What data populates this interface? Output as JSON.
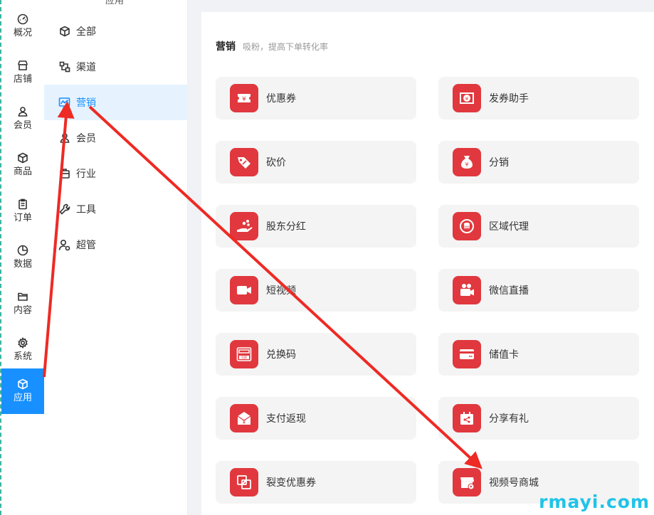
{
  "rail": {
    "items": [
      {
        "label": "概况",
        "icon": "dashboard-icon"
      },
      {
        "label": "店铺",
        "icon": "store-icon"
      },
      {
        "label": "会员",
        "icon": "user-icon"
      },
      {
        "label": "商品",
        "icon": "box-icon"
      },
      {
        "label": "订单",
        "icon": "clipboard-icon"
      },
      {
        "label": "数据",
        "icon": "pie-icon"
      },
      {
        "label": "内容",
        "icon": "folder-icon"
      },
      {
        "label": "系统",
        "icon": "gear-icon"
      },
      {
        "label": "应用",
        "icon": "cube-icon",
        "active": true
      }
    ]
  },
  "submenu": {
    "title": "应用",
    "items": [
      {
        "label": "全部",
        "icon": "cube-icon"
      },
      {
        "label": "渠道",
        "icon": "channel-icon"
      },
      {
        "label": "营销",
        "icon": "marketing-chart-icon",
        "active": true
      },
      {
        "label": "会员",
        "icon": "user-icon"
      },
      {
        "label": "行业",
        "icon": "industry-icon"
      },
      {
        "label": "工具",
        "icon": "wrench-icon"
      },
      {
        "label": "超管",
        "icon": "admin-icon"
      }
    ]
  },
  "section": {
    "title": "营销",
    "subtitle": "吸粉，提高下单转化率"
  },
  "cards": [
    {
      "label": "优惠券",
      "icon": "coupon-icon"
    },
    {
      "label": "发券助手",
      "icon": "coupon-assistant-icon"
    },
    {
      "label": "砍价",
      "icon": "bargain-icon"
    },
    {
      "label": "分销",
      "icon": "money-bag-icon"
    },
    {
      "label": "股东分红",
      "icon": "dividend-icon"
    },
    {
      "label": "区域代理",
      "icon": "region-agent-icon"
    },
    {
      "label": "短视频",
      "icon": "video-camera-icon"
    },
    {
      "label": "微信直播",
      "icon": "live-stream-icon"
    },
    {
      "label": "兑换码",
      "icon": "redeem-code-icon",
      "badge_text": "兑换"
    },
    {
      "label": "储值卡",
      "icon": "stored-value-card-icon"
    },
    {
      "label": "支付返现",
      "icon": "cashback-icon"
    },
    {
      "label": "分享有礼",
      "icon": "share-gift-icon"
    },
    {
      "label": "裂变优惠券",
      "icon": "fission-coupon-icon"
    },
    {
      "label": "视频号商城",
      "icon": "video-shop-icon"
    }
  ],
  "watermark": "rmayi.com",
  "colors": {
    "accent": "#1890ff",
    "card_icon_bg": "#e0383e",
    "arrow": "#ee2a24",
    "watermark": "#21c3e8"
  }
}
